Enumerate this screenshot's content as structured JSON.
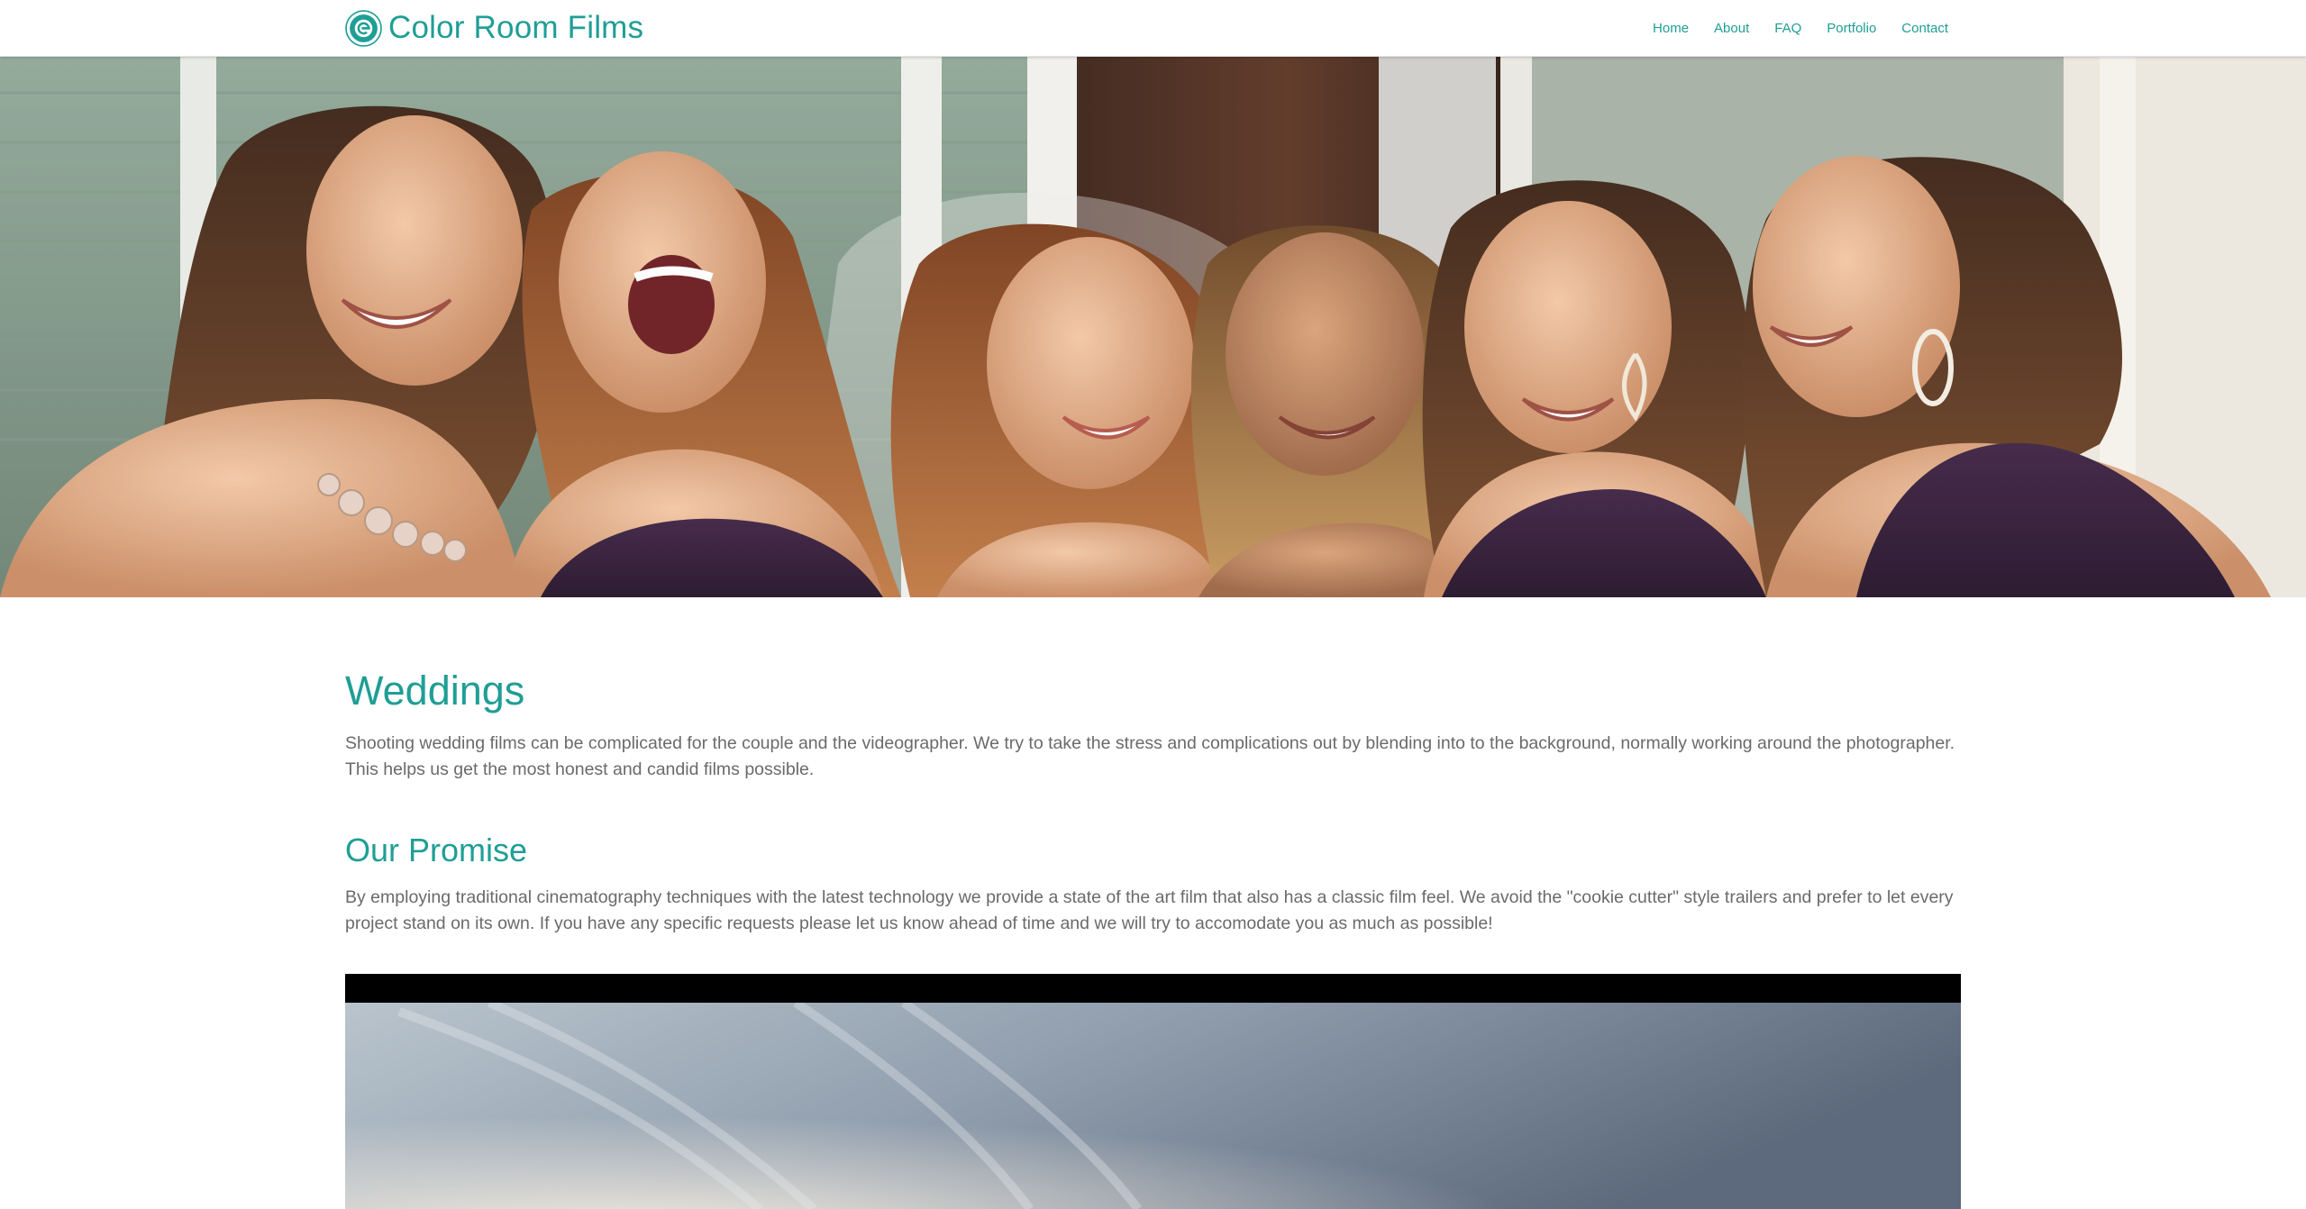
{
  "header": {
    "brand": "Color Room Films",
    "nav": [
      {
        "label": "Home"
      },
      {
        "label": "About"
      },
      {
        "label": "FAQ"
      },
      {
        "label": "Portfolio"
      },
      {
        "label": "Contact"
      }
    ]
  },
  "main": {
    "weddings": {
      "title": "Weddings",
      "text": "Shooting wedding films can be complicated for the couple and the videographer. We try to take the stress and complications out by blending into to the background, normally working around the photographer. This helps us get the most honest and candid films possible."
    },
    "promise": {
      "title": "Our Promise",
      "text": "By employing traditional cinematography techniques with the latest technology we provide a state of the art film that also has a classic film feel. We avoid the \"cookie cutter\" style trailers and prefer to let every project stand on its own. If you have any specific requests please let us know ahead of time and we will try to accomodate you as much as possible!"
    }
  },
  "colors": {
    "accent": "#1f9e95",
    "body_text": "#6a6a6a",
    "background": "#ffffff"
  },
  "icons": {
    "logo": "film-reel-logo-icon"
  }
}
